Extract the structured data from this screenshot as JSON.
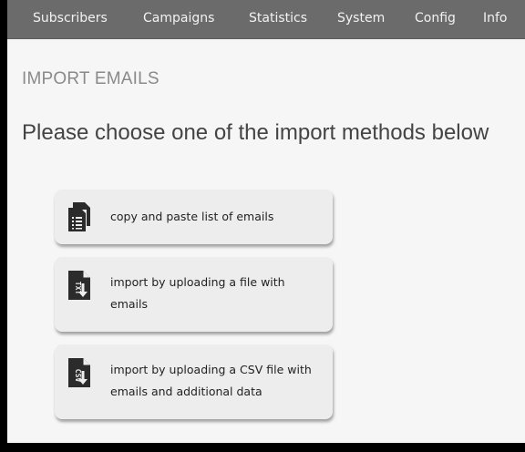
{
  "nav": {
    "items": [
      {
        "id": "subscribers",
        "label": "Subscribers"
      },
      {
        "id": "campaigns",
        "label": "Campaigns"
      },
      {
        "id": "statistics",
        "label": "Statistics"
      },
      {
        "id": "system",
        "label": "System"
      },
      {
        "id": "config",
        "label": "Config"
      },
      {
        "id": "info",
        "label": "Info"
      }
    ]
  },
  "page": {
    "section_title": "IMPORT EMAILS",
    "heading": "Please choose one of the import methods below"
  },
  "methods": [
    {
      "id": "copy-paste",
      "icon": "clipboard-list-icon",
      "label": "copy and paste list of emails"
    },
    {
      "id": "upload-file",
      "icon": "txt-file-download-icon",
      "label": "import by uploading a file with emails"
    },
    {
      "id": "upload-csv",
      "icon": "csv-file-download-icon",
      "label": "import by uploading a CSV file with emails and additional data"
    }
  ],
  "colors": {
    "nav_background": "#6b6b6b",
    "page_background": "#f6f6f6",
    "button_background": "#ededed",
    "icon_color": "#2b2b2b"
  }
}
